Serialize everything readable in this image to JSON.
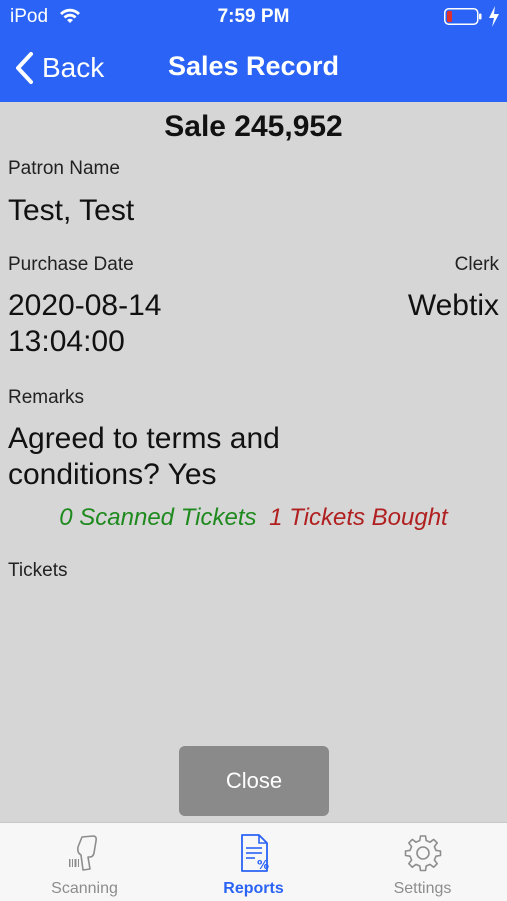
{
  "status_bar": {
    "carrier": "iPod",
    "time": "7:59 PM"
  },
  "nav": {
    "back_label": "Back",
    "title": "Sales Record"
  },
  "sale": {
    "heading": "Sale 245,952",
    "patron_name_label": "Patron Name",
    "patron_name": "Test, Test",
    "purchase_date_label": "Purchase Date",
    "purchase_date_line1": "2020-08-14",
    "purchase_date_line2": "13:04:00",
    "clerk_label": "Clerk",
    "clerk": "Webtix",
    "remarks_label": "Remarks",
    "remarks_line1": "Agreed to terms and",
    "remarks_line2": "conditions? Yes",
    "scanned_tickets": "0 Scanned Tickets",
    "tickets_bought": "1 Tickets Bought",
    "tickets_label": "Tickets"
  },
  "close_label": "Close",
  "tabs": [
    {
      "label": "Scanning",
      "icon": "barcode-scanner-icon",
      "active": false
    },
    {
      "label": "Reports",
      "icon": "report-document-icon",
      "active": true
    },
    {
      "label": "Settings",
      "icon": "gear-icon",
      "active": false
    }
  ],
  "colors": {
    "accent": "#2a63f5",
    "scanned": "#1e8a1e",
    "bought": "#b02020",
    "battery_low": "#e03030"
  }
}
